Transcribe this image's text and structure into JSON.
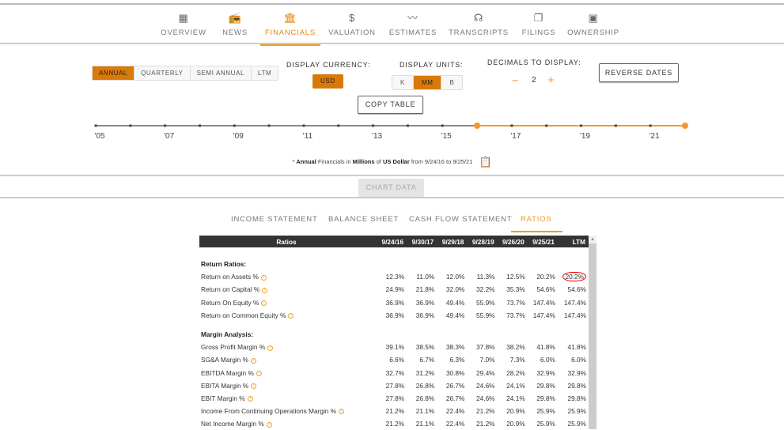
{
  "nav": {
    "items": [
      {
        "label": "OVERVIEW",
        "icon": "building-icon",
        "glyph": "▦"
      },
      {
        "label": "NEWS",
        "icon": "radio-icon",
        "glyph": "📻"
      },
      {
        "label": "FINANCIALS",
        "icon": "bank-icon",
        "glyph": "🏛"
      },
      {
        "label": "VALUATION",
        "icon": "dollar-icon",
        "glyph": "$"
      },
      {
        "label": "ESTIMATES",
        "icon": "trend-line-icon",
        "glyph": "〰"
      },
      {
        "label": "TRANSCRIPTS",
        "icon": "speaker-icon",
        "glyph": "☊"
      },
      {
        "label": "FILINGS",
        "icon": "documents-icon",
        "glyph": "❐"
      },
      {
        "label": "OWNERSHIP",
        "icon": "briefcase-icon",
        "glyph": "▣"
      }
    ],
    "active": "FINANCIALS"
  },
  "period": {
    "options": [
      "ANNUAL",
      "QUARTERLY",
      "SEMI ANNUAL",
      "LTM"
    ],
    "selected": "ANNUAL"
  },
  "currency": {
    "label": "DISPLAY CURRENCY:",
    "value": "USD"
  },
  "units": {
    "label": "DISPLAY UNITS:",
    "options": [
      "K",
      "MM",
      "B"
    ],
    "selected": "MM"
  },
  "decimals": {
    "label": "DECIMALS TO DISPLAY:",
    "minus": "−",
    "value": "2",
    "plus": "+"
  },
  "reverse_dates": "REVERSE DATES",
  "copy_table": "COPY TABLE",
  "timeline": {
    "labels": [
      "'05",
      "'07",
      "'09",
      "'11",
      "'13",
      "'15",
      "'17",
      "'19",
      "'21"
    ],
    "start_year": 2005,
    "end_year": 2022,
    "range": [
      2016,
      2022
    ],
    "accent": "#f19a2a"
  },
  "note": {
    "prefix": "* ",
    "period": "Annual",
    "mid1": " Financials in ",
    "units": "Millions",
    "mid2": " of ",
    "currency": "US Dollar",
    "mid3": " from 9/24/16 to 9/25/21"
  },
  "chart_data_button": "CHART DATA",
  "statement_tabs": [
    "INCOME STATEMENT",
    "BALANCE SHEET",
    "CASH FLOW STATEMENT",
    "RATIOS"
  ],
  "table": {
    "headers": [
      "Ratios",
      "9/24/16",
      "9/30/17",
      "9/29/18",
      "9/28/19",
      "9/26/20",
      "9/25/21",
      "LTM"
    ],
    "sections": [
      {
        "title": "Return Ratios:",
        "rows": [
          {
            "label": "Return on Assets %",
            "values": [
              "12.3%",
              "11.0%",
              "12.0%",
              "11.3%",
              "12.5%",
              "20.2%",
              "20.2%"
            ]
          },
          {
            "label": "Return on Capital %",
            "values": [
              "24.9%",
              "21.8%",
              "32.0%",
              "32.2%",
              "35.3%",
              "54.6%",
              "54.6%"
            ]
          },
          {
            "label": "Return On Equity %",
            "values": [
              "36.9%",
              "36.9%",
              "49.4%",
              "55.9%",
              "73.7%",
              "147.4%",
              "147.4%"
            ]
          },
          {
            "label": "Return on Common Equity %",
            "values": [
              "36.9%",
              "36.9%",
              "49.4%",
              "55.9%",
              "73.7%",
              "147.4%",
              "147.4%"
            ]
          }
        ]
      },
      {
        "title": "Margin Analysis:",
        "rows": [
          {
            "label": "Gross Profit Margin %",
            "values": [
              "39.1%",
              "38.5%",
              "38.3%",
              "37.8%",
              "38.2%",
              "41.8%",
              "41.8%"
            ]
          },
          {
            "label": "SG&A Margin %",
            "values": [
              "6.6%",
              "6.7%",
              "6.3%",
              "7.0%",
              "7.3%",
              "6.0%",
              "6.0%"
            ]
          },
          {
            "label": "EBITDA Margin %",
            "values": [
              "32.7%",
              "31.2%",
              "30.8%",
              "29.4%",
              "28.2%",
              "32.9%",
              "32.9%"
            ]
          },
          {
            "label": "EBITA Margin %",
            "values": [
              "27.8%",
              "26.8%",
              "26.7%",
              "24.6%",
              "24.1%",
              "29.8%",
              "29.8%"
            ]
          },
          {
            "label": "EBIT Margin %",
            "values": [
              "27.8%",
              "26.8%",
              "26.7%",
              "24.6%",
              "24.1%",
              "29.8%",
              "29.8%"
            ]
          },
          {
            "label": "Income From Continuing Operations Margin %",
            "values": [
              "21.2%",
              "21.1%",
              "22.4%",
              "21.2%",
              "20.9%",
              "25.9%",
              "25.9%"
            ]
          },
          {
            "label": "Net Income Margin %",
            "values": [
              "21.2%",
              "21.1%",
              "22.4%",
              "21.2%",
              "20.9%",
              "25.9%",
              "25.9%"
            ]
          }
        ]
      }
    ]
  }
}
